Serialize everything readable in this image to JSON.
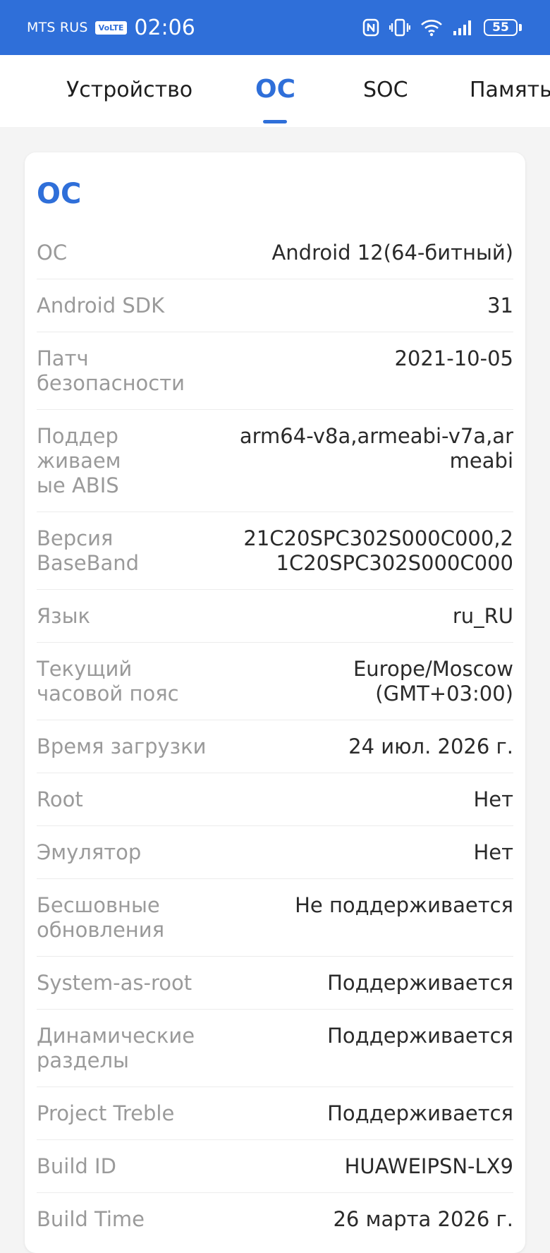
{
  "status_bar": {
    "carrier": "MTS RUS",
    "volte": "VoLTE",
    "time": "02:06",
    "battery": "55",
    "icons": [
      "nfc-icon",
      "vibrate-icon",
      "wifi-icon",
      "signal-icon",
      "battery-icon"
    ]
  },
  "tabs": [
    {
      "label": "Устройство",
      "active": false
    },
    {
      "label": "ОС",
      "active": true
    },
    {
      "label": "SOC",
      "active": false
    },
    {
      "label": "Память",
      "active": false
    }
  ],
  "section": {
    "title": "ОС",
    "rows": [
      {
        "label": "ОС",
        "value": "Android 12(64-битный)"
      },
      {
        "label": "Android SDK",
        "value": "31"
      },
      {
        "label": "Патч безопасности",
        "value": "2021-10-05"
      },
      {
        "label": "Поддерживаемые ABIS",
        "value": "arm64-v8a,armeabi-v7a,armeabi"
      },
      {
        "label": "Версия BaseBand",
        "value": "21C20SPC302S000C000,21C20SPC302S000C000"
      },
      {
        "label": "Язык",
        "value": "ru_RU"
      },
      {
        "label": "Текущий часовой пояс",
        "value": "Europe/Moscow (GMT+03:00)"
      },
      {
        "label": "Время загрузки",
        "value": "24 июл. 2026 г."
      },
      {
        "label": "Root",
        "value": "Нет"
      },
      {
        "label": "Эмулятор",
        "value": "Нет"
      },
      {
        "label": "Бесшовные обновления",
        "value": "Не поддерживается"
      },
      {
        "label": "System-as-root",
        "value": "Поддерживается"
      },
      {
        "label": "Динамические разделы",
        "value": "Поддерживается"
      },
      {
        "label": "Project Treble",
        "value": "Поддерживается"
      },
      {
        "label": "Build ID",
        "value": "HUAWEIPSN-LX9"
      },
      {
        "label": "Build Time",
        "value": "26 марта 2026 г."
      }
    ]
  },
  "colors": {
    "accent": "#2f6fd9",
    "label": "#9a9a9a",
    "value": "#2a2a2a"
  }
}
